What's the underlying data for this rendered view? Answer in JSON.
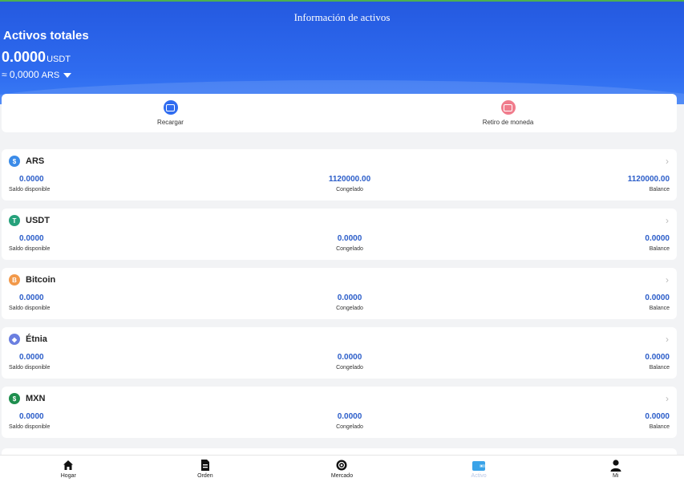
{
  "header": {
    "title": "Información de activos",
    "total_label": "Activos totales",
    "total_value": "0.0000",
    "total_unit": "USDT",
    "approx_value": "≈ 0,0000",
    "approx_currency": "ARS"
  },
  "actions": [
    {
      "label": "Recargar",
      "icon": "wallet-icon",
      "color": "#2f6cf0"
    },
    {
      "label": "Retiro de moneda",
      "icon": "withdraw-icon",
      "color": "#f07c8c"
    }
  ],
  "assets": [
    {
      "name": "ARS",
      "coin_color": "#3b8be8",
      "symbol": "$",
      "available": "0.0000",
      "frozen": "1120000.00",
      "balance": "1120000.00"
    },
    {
      "name": "USDT",
      "coin_color": "#26a17b",
      "symbol": "T",
      "available": "0.0000",
      "frozen": "0.0000",
      "balance": "0.0000"
    },
    {
      "name": "Bitcoin",
      "coin_color": "#f2994a",
      "symbol": "B",
      "available": "0.0000",
      "frozen": "0.0000",
      "balance": "0.0000"
    },
    {
      "name": "Étnia",
      "coin_color": "#6b7fe0",
      "symbol": "◆",
      "available": "0.0000",
      "frozen": "0.0000",
      "balance": "0.0000"
    },
    {
      "name": "MXN",
      "coin_color": "#1e8e4e",
      "symbol": "$",
      "available": "0.0000",
      "frozen": "0.0000",
      "balance": "0.0000"
    }
  ],
  "labels": {
    "available": "Saldo disponible",
    "frozen": "Congelado",
    "balance": "Balance"
  },
  "nav": [
    {
      "label": "Hogar",
      "icon": "home-icon"
    },
    {
      "label": "Orden",
      "icon": "document-icon"
    },
    {
      "label": "Mercado",
      "icon": "market-icon"
    },
    {
      "label": "Activo",
      "icon": "wallet-icon",
      "active": true
    },
    {
      "label": "Mi",
      "icon": "user-icon"
    }
  ],
  "colors": {
    "header": "#2f6cf0",
    "value": "#2b5dc9",
    "active_nav": "#3aa3e8"
  }
}
